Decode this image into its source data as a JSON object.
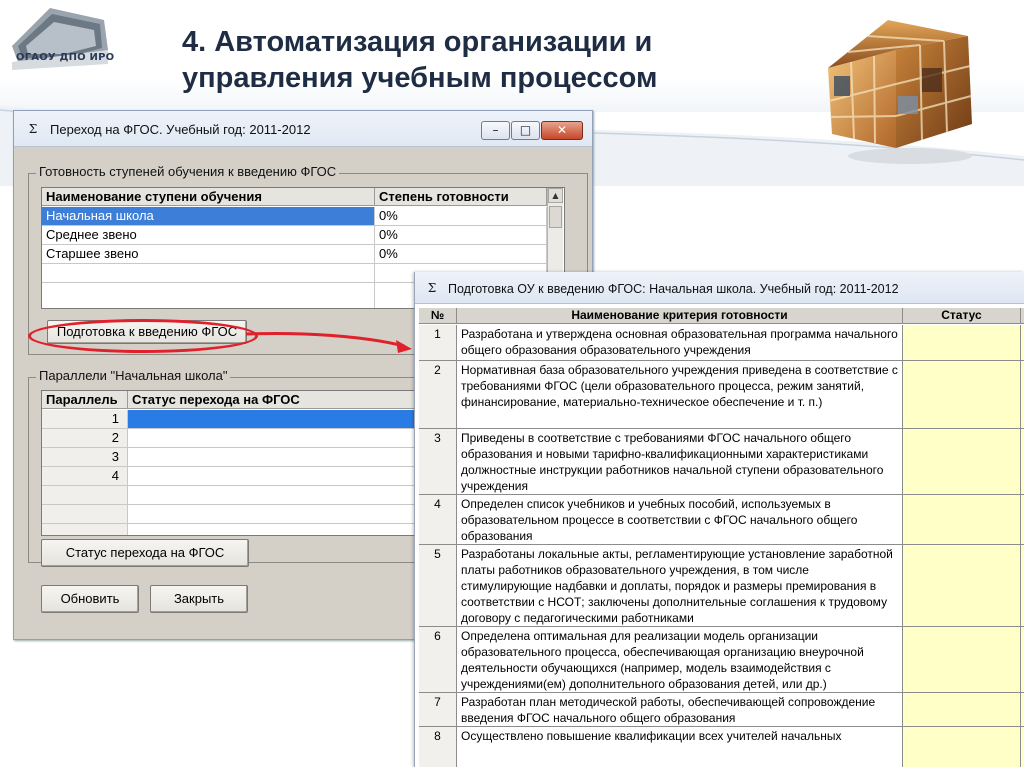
{
  "slide": {
    "title_line1": "4. Автоматизация организации и",
    "title_line2": "управления учебным процессом",
    "logo_text": "ОГАОУ ДПО ИРО"
  },
  "window1": {
    "title": "Переход на ФГОС. Учебный год: 2011-2012",
    "controls": {
      "minimize": "–",
      "maximize": "□",
      "close": "✕"
    },
    "group1": {
      "legend": "Готовность ступеней обучения к введению ФГОС",
      "columns": [
        "Наименование ступени обучения",
        "Степень готовности"
      ],
      "rows": [
        {
          "name": "Начальная школа",
          "value": "0%"
        },
        {
          "name": "Среднее звено",
          "value": "0%"
        },
        {
          "name": "Старшее звено",
          "value": "0%"
        }
      ],
      "button": "Подготовка к введению ФГОС"
    },
    "group2": {
      "legend": "Параллели \"Начальная школа\"",
      "columns": [
        "Параллель",
        "Статус перехода на ФГОС"
      ],
      "rows": [
        {
          "num": "1"
        },
        {
          "num": "2"
        },
        {
          "num": "3"
        },
        {
          "num": "4"
        }
      ]
    },
    "status_button": "Статус перехода на ФГОС",
    "refresh_button": "Обновить",
    "close_button": "Закрыть"
  },
  "window2": {
    "title": "Подготовка ОУ к введению ФГОС: Начальная школа. Учебный год: 2011-2012",
    "columns": [
      "№",
      "Наименование критерия готовности",
      "Статус"
    ],
    "rows": [
      {
        "num": "1",
        "text": "Разработана и утверждена основная образовательная программа начального общего образования образовательного учреждения"
      },
      {
        "num": "2",
        "text": "Нормативная база образовательного учреждения приведена в соответствие с требованиями ФГОС (цели образовательного процесса, режим занятий, финансирование, материально-техническое обеспечение и т. п.)"
      },
      {
        "num": "3",
        "text": "Приведены в соответствие с требованиями ФГОС начального общего образования и новыми тарифно-квалификационными характеристиками должностные инструкции работников начальной ступени образовательного учреждения"
      },
      {
        "num": "4",
        "text": "Определен список учебников и учебных пособий, используемых в образовательном процессе в соответствии с ФГОС начального общего образования"
      },
      {
        "num": "5",
        "text": "Разработаны локальные акты, регламентирующие установление заработной платы работников образовательного учреждения, в том числе стимулирующие надбавки и доплаты, порядок и размеры премирования в соответствии с НСОТ; заключены дополнительные соглашения к трудовому договору с педагогическими работниками"
      },
      {
        "num": "6",
        "text": "Определена оптимальная для реализации модель организации образовательного процесса, обеспечивающая организацию внеурочной деятельности обучающихся (например, модель взаимодействия с учреждениями(ем) дополнительного образования детей, или др.)"
      },
      {
        "num": "7",
        "text": "Разработан план методической работы, обеспечивающей сопровождение введения ФГОС начального общего образования"
      },
      {
        "num": "8",
        "text": "Осуществлено повышение квалификации всех учителей начальных"
      }
    ]
  },
  "colors": {
    "selection": "#3d7fd8",
    "status_cell": "#ffffc8",
    "highlight_oval": "#e0202a",
    "title_text": "#1f2d44"
  },
  "icons": [
    "sigma-icon",
    "minimize-icon",
    "maximize-icon",
    "close-icon",
    "scroll-up-icon",
    "scroll-down-icon",
    "arrow-icon",
    "cube-image"
  ]
}
